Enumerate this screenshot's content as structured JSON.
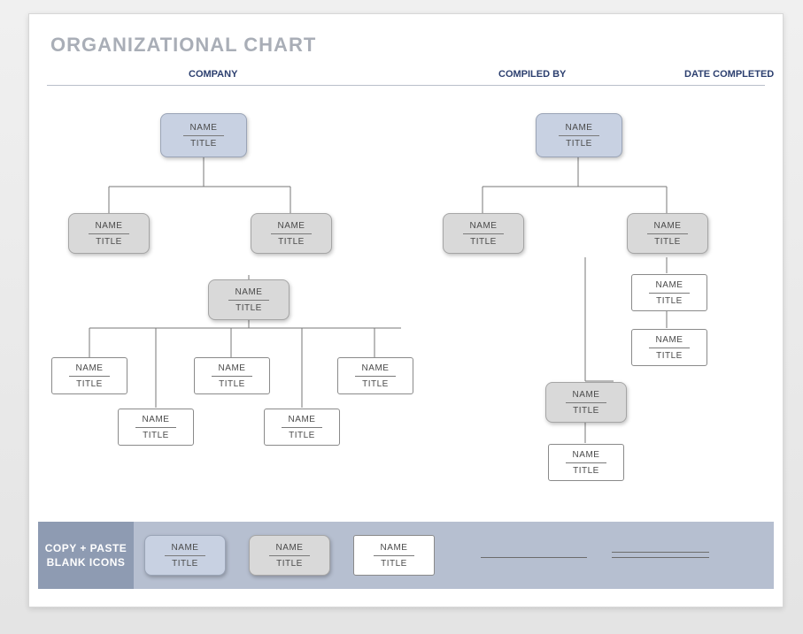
{
  "title": "ORGANIZATIONAL CHART",
  "headers": {
    "company": "COMPANY",
    "compiled": "COMPILED BY",
    "date": "DATE COMPLETED"
  },
  "placeholder": {
    "name": "NAME",
    "title": "TITLE"
  },
  "footer": {
    "label_line1": "COPY + PASTE",
    "label_line2": "BLANK ICONS"
  },
  "colors": {
    "blue": "#c8d1e2",
    "gray": "#d9d9d9",
    "white": "#ffffff",
    "footer_dark": "#8e9bb2",
    "footer_light": "#b6bfd0",
    "heading": "#2c3f6f"
  },
  "chart_data": {
    "type": "tree",
    "trees": [
      {
        "root": {
          "name": "NAME",
          "title": "TITLE",
          "style": "blue"
        },
        "children": [
          {
            "name": "NAME",
            "title": "TITLE",
            "style": "gray"
          },
          {
            "name": "NAME",
            "title": "TITLE",
            "style": "gray",
            "children": [
              {
                "name": "NAME",
                "title": "TITLE",
                "style": "white"
              },
              {
                "name": "NAME",
                "title": "TITLE",
                "style": "white"
              },
              {
                "name": "NAME",
                "title": "TITLE",
                "style": "white"
              },
              {
                "name": "NAME",
                "title": "TITLE",
                "style": "white"
              },
              {
                "name": "NAME",
                "title": "TITLE",
                "style": "white"
              }
            ]
          }
        ]
      },
      {
        "root": {
          "name": "NAME",
          "title": "TITLE",
          "style": "blue"
        },
        "children": [
          {
            "name": "NAME",
            "title": "TITLE",
            "style": "gray"
          },
          {
            "name": "NAME",
            "title": "TITLE",
            "style": "gray",
            "children": [
              {
                "name": "NAME",
                "title": "TITLE",
                "style": "white"
              },
              {
                "name": "NAME",
                "title": "TITLE",
                "style": "white",
                "children": [
                  {
                    "name": "NAME",
                    "title": "TITLE",
                    "style": "gray",
                    "children": [
                      {
                        "name": "NAME",
                        "title": "TITLE",
                        "style": "white"
                      }
                    ]
                  }
                ]
              }
            ]
          }
        ]
      }
    ],
    "palette": [
      {
        "style": "blue",
        "name": "NAME",
        "title": "TITLE"
      },
      {
        "style": "gray",
        "name": "NAME",
        "title": "TITLE"
      },
      {
        "style": "white",
        "name": "NAME",
        "title": "TITLE"
      }
    ]
  }
}
